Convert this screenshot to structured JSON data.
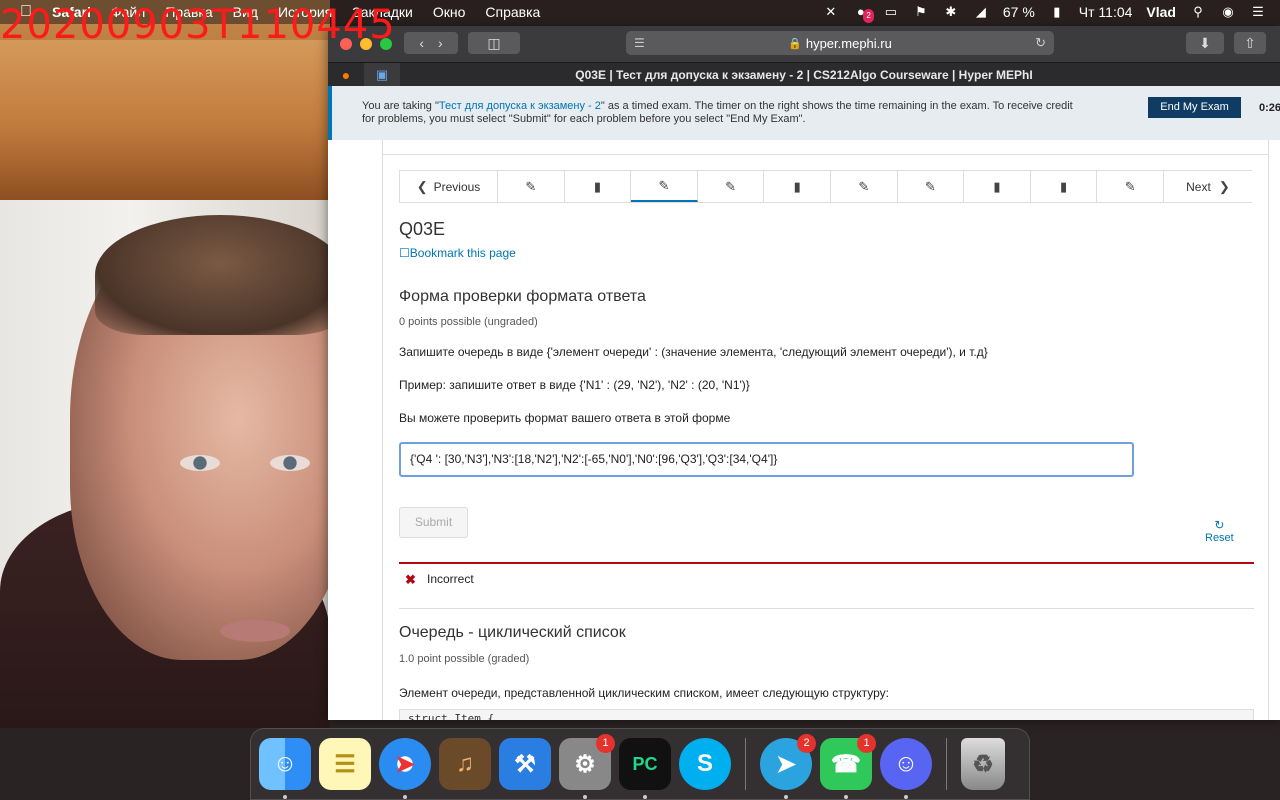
{
  "overlay": {
    "timestamp": "20200903T110445"
  },
  "menubar": {
    "apple": "",
    "app_name": "Safari",
    "menus": [
      "Файл",
      "Правка",
      "Вид",
      "История",
      "Закладки",
      "Окно",
      "Справка"
    ],
    "notification_count": "2",
    "battery": "67 %",
    "clock": "Чт 11:04",
    "user": "Vlad"
  },
  "browser": {
    "address": "hyper.mephi.ru",
    "tab_title": "Q03E | Тест для допуска к экзамену - 2 | CS212Algo Courseware | Hyper MEPhI"
  },
  "exam_banner": {
    "text_before": "You are taking \"",
    "exam_link": "Тест для допуска к экзамену - 2",
    "text_after": "\" as a timed exam. The timer on the right shows the time remaining in the exam. To receive credit for problems, you must select \"Submit\" for each problem before you select \"End My Exam\".",
    "end_button": "End My Exam",
    "timer": "0:26:"
  },
  "sequence_nav": {
    "previous": "Previous",
    "next": "Next",
    "tabs": [
      {
        "icon": "edit-icon",
        "active": false
      },
      {
        "icon": "book-icon",
        "active": false
      },
      {
        "icon": "edit-icon",
        "active": true
      },
      {
        "icon": "edit-icon",
        "active": false
      },
      {
        "icon": "book-icon",
        "active": false
      },
      {
        "icon": "edit-icon",
        "active": false
      },
      {
        "icon": "edit-icon",
        "active": false
      },
      {
        "icon": "book-icon",
        "active": false
      },
      {
        "icon": "book-icon",
        "active": false
      },
      {
        "icon": "edit-icon",
        "active": false
      }
    ]
  },
  "unit": {
    "title": "Q03E",
    "bookmark": "Bookmark this page"
  },
  "problem1": {
    "title": "Форма проверки формата ответа",
    "points": "0 points possible (ungraded)",
    "p1": "Запишите очередь в виде {'элемент очереди' : (значение элемента, 'следующий элемент очереди'), и т.д}",
    "p2": "Пример: запишите ответ в виде {'N1' : (29, 'N2'), 'N2' : (20, 'N1')}",
    "p3": "Вы можете проверить формат вашего ответа в этой форме",
    "answer": "{'Q4 ': [30,'N3'],'N3':[18,'N2'],'N2':[-65,'N0'],'N0':[96,'Q3'],'Q3':[34,'Q4']}",
    "submit": "Submit",
    "reset": "Reset",
    "feedback": "Incorrect"
  },
  "problem2": {
    "title": "Очередь - циклический список",
    "points": "1.0 point possible (graded)",
    "text": "Элемент очереди, представленной циклическим списком, имеет следующую структуру:",
    "code": "struct Item {"
  },
  "dock": {
    "apps": [
      {
        "name": "Finder",
        "badge": ""
      },
      {
        "name": "Notes",
        "badge": ""
      },
      {
        "name": "Safari",
        "badge": ""
      },
      {
        "name": "GarageBand",
        "badge": ""
      },
      {
        "name": "Xcode",
        "badge": ""
      },
      {
        "name": "System Preferences",
        "badge": "1"
      },
      {
        "name": "PyCharm",
        "badge": ""
      },
      {
        "name": "Skype",
        "badge": ""
      },
      {
        "name": "Telegram",
        "badge": "2"
      },
      {
        "name": "FaceTime",
        "badge": "1"
      },
      {
        "name": "Discord",
        "badge": ""
      },
      {
        "name": "Trash",
        "badge": ""
      }
    ]
  },
  "colors": {
    "link": "#0075b4",
    "error": "#b20610",
    "end_exam_bg": "#0e3c63"
  }
}
